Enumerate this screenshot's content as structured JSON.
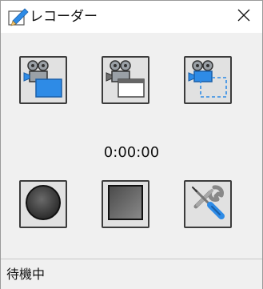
{
  "window": {
    "title": "レコーダー",
    "title_icon": "pencil-edit-icon",
    "close_icon": "close-icon"
  },
  "toolbar_top": [
    {
      "id": "record-fullscreen",
      "icon": "camera-fullscreen-icon"
    },
    {
      "id": "record-window",
      "icon": "camera-window-icon"
    },
    {
      "id": "record-region",
      "icon": "camera-region-icon"
    }
  ],
  "timer": {
    "value": "0:00:00"
  },
  "toolbar_bottom": [
    {
      "id": "record",
      "icon": "record-circle-icon"
    },
    {
      "id": "stop",
      "icon": "stop-square-icon"
    },
    {
      "id": "settings",
      "icon": "tools-wrench-screwdriver-icon"
    }
  ],
  "status": {
    "text": "待機中"
  },
  "colors": {
    "accent_blue": "#2e8be6",
    "frame_gray": "#f0f0f0",
    "button_face": "#e1e1e1",
    "border_dark": "#3c3c3c"
  }
}
